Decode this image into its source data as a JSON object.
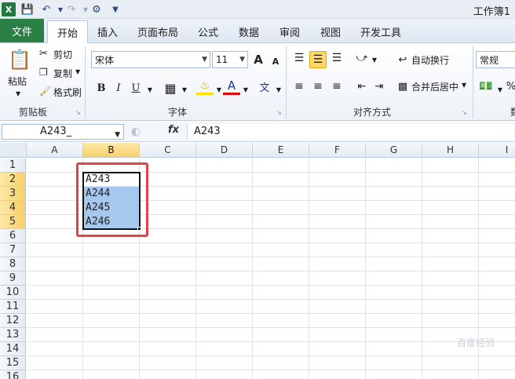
{
  "app": {
    "title": "工作簿1"
  },
  "tabs": [
    "文件",
    "开始",
    "插入",
    "页面布局",
    "公式",
    "数据",
    "审阅",
    "视图",
    "开发工具"
  ],
  "active_tab": "开始",
  "ribbon": {
    "clipboard": {
      "paste": "粘贴",
      "cut": "剪切",
      "copy": "复制",
      "format_painter": "格式刷",
      "label": "剪贴板"
    },
    "font": {
      "name": "宋体",
      "size": "11",
      "grow": "A",
      "shrink": "A",
      "bold": "B",
      "italic": "I",
      "underline": "U",
      "color_letter": "A",
      "phonetic": "文",
      "label": "字体"
    },
    "alignment": {
      "wrap": "自动换行",
      "merge": "合并后居中",
      "label": "对齐方式"
    },
    "number": {
      "format": "常规",
      "percent": "%",
      "label": "数"
    }
  },
  "formula_bar": {
    "name_box": "A243_",
    "fx": "fx",
    "content": "A243"
  },
  "columns": [
    "A",
    "B",
    "C",
    "D",
    "E",
    "F",
    "G",
    "H",
    "I"
  ],
  "selected_column": "B",
  "rows": [
    "1",
    "2",
    "3",
    "4",
    "5",
    "6",
    "7",
    "8",
    "9",
    "10",
    "11",
    "12",
    "13",
    "14",
    "15",
    "16"
  ],
  "selected_rows": [
    "2",
    "3",
    "4",
    "5"
  ],
  "cells": [
    {
      "ref": "B2",
      "value": "A243"
    },
    {
      "ref": "B3",
      "value": "A244"
    },
    {
      "ref": "B4",
      "value": "A245"
    },
    {
      "ref": "B5",
      "value": "A246"
    }
  ],
  "colors": {
    "file_tab": "#2a7f45",
    "selection_fill": "#a6c8ee",
    "highlight_box": "#e2434b",
    "header_selected": "#f8cf6a"
  },
  "watermark": "百度经验"
}
